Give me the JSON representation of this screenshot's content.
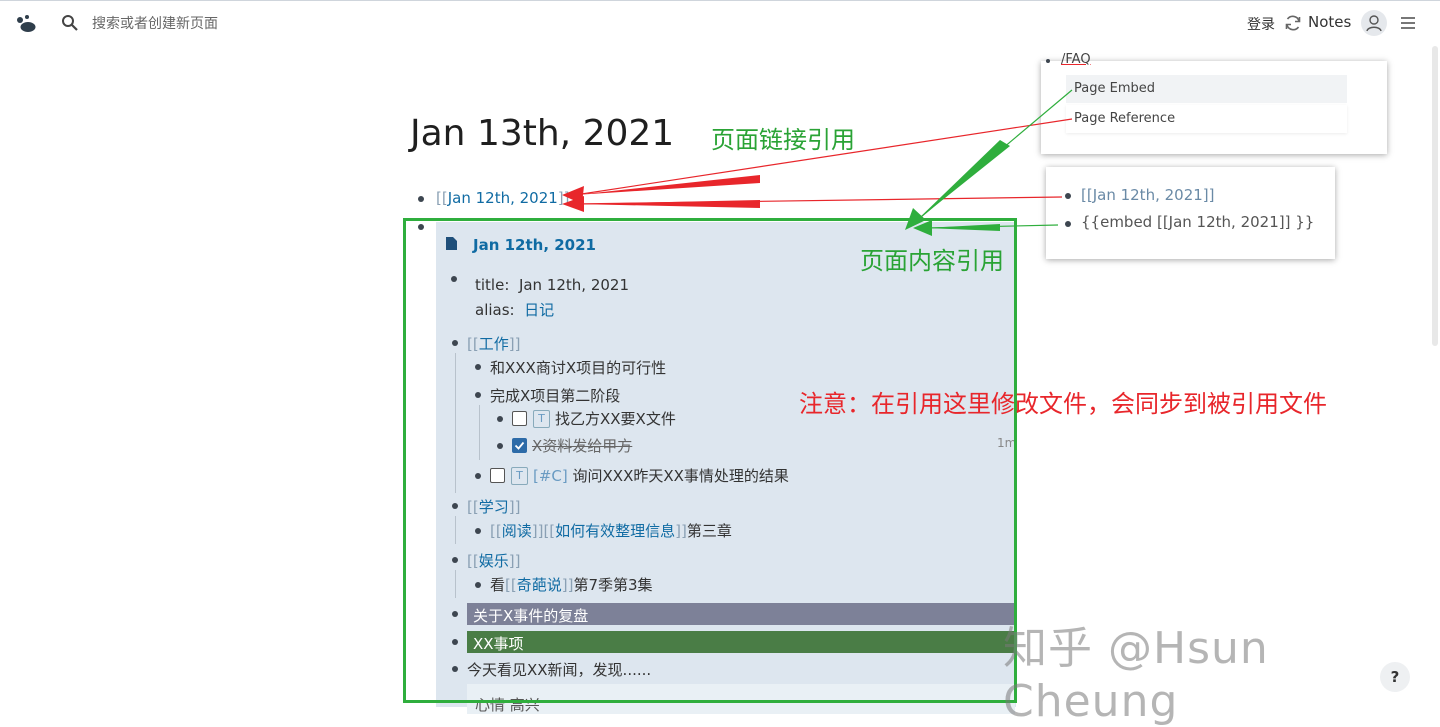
{
  "topbar": {
    "search_placeholder": "搜索或者创建新页面",
    "login": "登录",
    "notes": "Notes"
  },
  "page": {
    "title": "Jan 13th, 2021",
    "block1_link": "Jan 12th, 2021",
    "embed": {
      "title": "Jan 12th, 2021",
      "prop_title_key": "title:",
      "prop_title_val": "Jan 12th, 2021",
      "prop_alias_key": "alias:",
      "prop_alias_val": "日记",
      "work": "工作",
      "work_item1": "和XXX商讨X项目的可行性",
      "work_item2": "完成X项目第二阶段",
      "task1_marker": "T",
      "task1": "找乙方XX要X文件",
      "task2": "X资料发给甲方",
      "task2_time": "1m",
      "task3_marker": "T",
      "task3_tag": "[#C]",
      "task3": "询问XXX昨天XX事情处理的结果",
      "study": "学习",
      "study_link1": "阅读",
      "study_link2": "如何有效整理信息",
      "study_suffix": "第三章",
      "fun": "娱乐",
      "fun_prefix": "看",
      "fun_link": "奇葩说",
      "fun_suffix": "第7季第3集",
      "hl_gray": "关于X事件的复盘",
      "hl_green": "XX事项",
      "news": "今天看见XX新闻，发现......",
      "quote": "心情 高兴"
    }
  },
  "popup_slash": {
    "typed": "/FAQ",
    "item1": "Page Embed",
    "item2": "Page Reference"
  },
  "popup_examples": {
    "ref": "[[Jan 12th, 2021]]",
    "embed": "{{embed [[Jan 12th, 2021]] }}"
  },
  "annotations": {
    "link_ref": "页面链接引用",
    "content_ref": "页面内容引用",
    "note": "注意：在引用这里修改文件，会同步到被引用文件"
  },
  "watermark": "知乎 @Hsun Cheung",
  "help": "?",
  "colors": {
    "link": "#106ba3",
    "annotation_green": "#2aa335",
    "annotation_red": "#e8262b",
    "highlight_gray": "#7d8198",
    "highlight_green": "#4a7d46"
  }
}
